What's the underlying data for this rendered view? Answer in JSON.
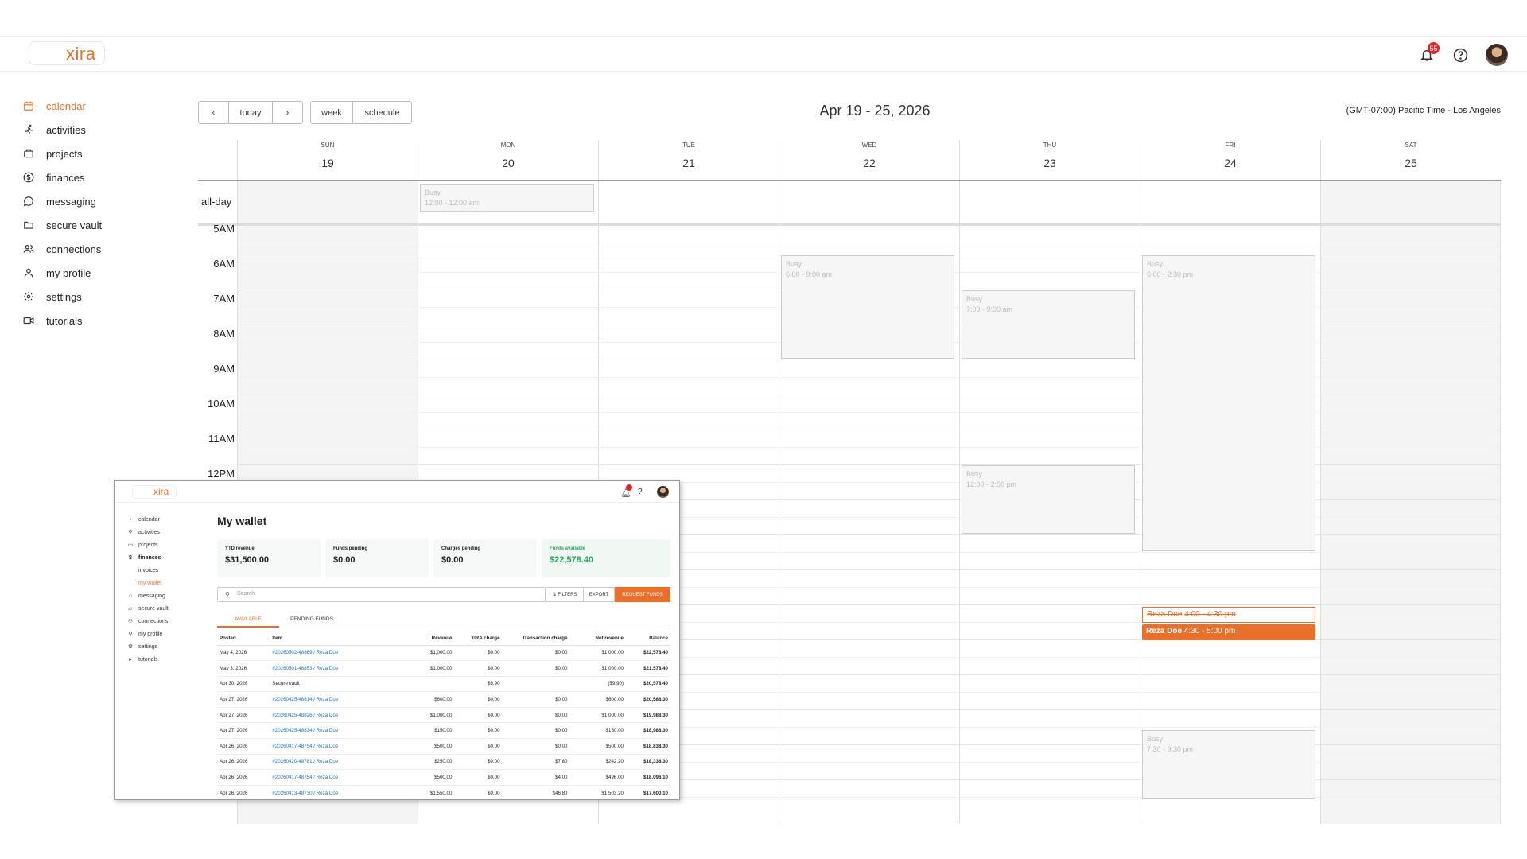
{
  "header": {
    "logo": "xira",
    "notification_count": "55",
    "icons": [
      "bell-icon",
      "help-icon",
      "avatar"
    ]
  },
  "sidebar": {
    "items": [
      {
        "label": "calendar",
        "icon": "calendar-icon",
        "active": true
      },
      {
        "label": "activities",
        "icon": "runner-icon"
      },
      {
        "label": "projects",
        "icon": "briefcase-icon"
      },
      {
        "label": "finances",
        "icon": "dollar-icon"
      },
      {
        "label": "messaging",
        "icon": "chat-icon"
      },
      {
        "label": "secure vault",
        "icon": "folder-icon"
      },
      {
        "label": "connections",
        "icon": "people-icon"
      },
      {
        "label": "my profile",
        "icon": "user-icon"
      },
      {
        "label": "settings",
        "icon": "gear-icon"
      },
      {
        "label": "tutorials",
        "icon": "video-icon"
      }
    ]
  },
  "toolbar": {
    "prev": "‹",
    "today": "today",
    "next": "›",
    "week": "week",
    "schedule": "schedule",
    "title": "Apr 19 - 25, 2026",
    "timezone": "(GMT-07:00) Pacific Time - Los Angeles"
  },
  "calendar": {
    "days": [
      {
        "name": "SUN",
        "date": "19"
      },
      {
        "name": "MON",
        "date": "20"
      },
      {
        "name": "TUE",
        "date": "21"
      },
      {
        "name": "WED",
        "date": "22"
      },
      {
        "name": "THU",
        "date": "23"
      },
      {
        "name": "FRI",
        "date": "24"
      },
      {
        "name": "SAT",
        "date": "25"
      }
    ],
    "allday_label": "all-day",
    "hours": [
      "5AM",
      "6AM",
      "7AM",
      "8AM",
      "9AM",
      "10AM",
      "11AM",
      "12PM"
    ],
    "events": {
      "mon_allday": {
        "title": "Busy",
        "time": "12:00 - 12:00 am"
      },
      "wed": {
        "title": "Busy",
        "time": "6:00 - 9:00 am"
      },
      "thu_1": {
        "title": "Busy",
        "time": "7:00 - 9:00 am"
      },
      "thu_2": {
        "title": "Busy",
        "time": "12:00 - 2:00 pm"
      },
      "fri_1": {
        "title": "Busy",
        "time": "6:00 - 2:30 pm"
      },
      "fri_cancelled": {
        "title": "Reza Doe",
        "time": "4:00 - 4:30 pm"
      },
      "fri_booked": {
        "title": "Reza Doe",
        "time": "4:30 - 5:00 pm"
      },
      "fri_2": {
        "title": "Busy",
        "time": "7:30 - 9:30 pm"
      }
    }
  },
  "wallet": {
    "logo": "xira",
    "title": "My wallet",
    "nav": [
      {
        "label": "calendar"
      },
      {
        "label": "activities"
      },
      {
        "label": "projects"
      },
      {
        "label": "finances",
        "bold": true
      },
      {
        "label": "invoices",
        "sub": true
      },
      {
        "label": "my wallet",
        "sub": true,
        "active": true
      },
      {
        "label": "messaging"
      },
      {
        "label": "secure vault"
      },
      {
        "label": "connections"
      },
      {
        "label": "my profile"
      },
      {
        "label": "settings"
      },
      {
        "label": "tutorials"
      }
    ],
    "cards": [
      {
        "label": "YTD revenue",
        "value": "$31,500.00"
      },
      {
        "label": "Funds pending",
        "value": "$0.00"
      },
      {
        "label": "Charges pending",
        "value": "$0.00"
      },
      {
        "label": "Funds available",
        "value": "$22,578.40"
      }
    ],
    "search_placeholder": "Search",
    "filters": "FILTERS",
    "export": "EXPORT",
    "request_funds": "REQUEST FUNDS",
    "tabs": [
      "AVAILABLE",
      "PENDING FUNDS"
    ],
    "columns": [
      "Posted",
      "Item",
      "Revenue",
      "XIRA charge",
      "Transaction charge",
      "Net revenue",
      "Balance"
    ],
    "rows": [
      [
        "May 4, 2026",
        "#20260502-48869 / Reza Doe",
        "$1,000.00",
        "$0.00",
        "$0.00",
        "$1,000.00",
        "$22,578.40"
      ],
      [
        "May 3, 2026",
        "#20260501-48853 / Reza Doe",
        "$1,000.00",
        "$0.00",
        "$0.00",
        "$1,000.00",
        "$21,578.40"
      ],
      [
        "Apr 30, 2026",
        "Secure vault",
        "",
        "$9.90",
        "",
        "($9.90)",
        "$20,578.40"
      ],
      [
        "Apr 27, 2026",
        "#20260425-48814 / Reza Doe",
        "$600.00",
        "$0.00",
        "$0.00",
        "$600.00",
        "$20,588.30"
      ],
      [
        "Apr 27, 2026",
        "#20260425-48826 / Reza Doe",
        "$1,000.00",
        "$0.00",
        "$0.00",
        "$1,000.00",
        "$19,988.30"
      ],
      [
        "Apr 27, 2026",
        "#20260425-48834 / Reza Doe",
        "$150.00",
        "$0.00",
        "$0.00",
        "$150.00",
        "$18,988.30"
      ],
      [
        "Apr 26, 2026",
        "#20260417-48754 / Reza Doe",
        "$500.00",
        "$0.00",
        "$0.00",
        "$500.00",
        "$18,838.30"
      ],
      [
        "Apr 26, 2026",
        "#20260420-48781 / Reza Doe",
        "$250.00",
        "$0.00",
        "$7.80",
        "$242.20",
        "$18,338.30"
      ],
      [
        "Apr 26, 2026",
        "#20260417-48754 / Reza Doe",
        "$500.00",
        "$0.00",
        "$4.00",
        "$496.00",
        "$18,096.10"
      ],
      [
        "Apr 26, 2026",
        "#20260413-48730 / Reza Doe",
        "$1,550.00",
        "$0.00",
        "$46.80",
        "$1,503.20",
        "$17,600.10"
      ]
    ]
  },
  "colors": {
    "accent": "#e8702a",
    "link": "#1a73c8",
    "positive": "#2aa55a",
    "badge": "#e02424"
  }
}
